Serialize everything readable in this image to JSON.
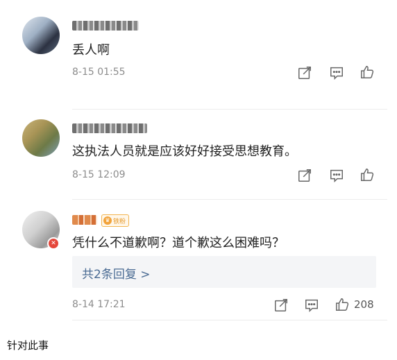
{
  "comments": [
    {
      "username": "",
      "text": "丢人啊",
      "time": "8-15 01:55",
      "actions": {
        "share_icon": "share-icon",
        "reply_icon": "comment-icon",
        "like_icon": "thumbs-up-icon"
      }
    },
    {
      "username": "",
      "text": "这执法人员就是应该好好接受思想教育。",
      "time": "8-15 12:09",
      "actions": {
        "share_icon": "share-icon",
        "reply_icon": "comment-icon",
        "like_icon": "thumbs-up-icon"
      }
    },
    {
      "username": "",
      "badge": "铁粉",
      "text": "凭什么不道歉啊？道个歉这么困难吗？",
      "replies_label": "共2条回复 >",
      "time": "8-14 17:21",
      "like_count": "208",
      "actions": {
        "share_icon": "share-icon",
        "reply_icon": "comment-icon",
        "like_icon": "thumbs-up-icon"
      }
    }
  ],
  "footer": {
    "text": "针对此事"
  },
  "colors": {
    "link": "#4a6b93",
    "time": "#8c8c8c",
    "badge": "#f2a33a",
    "divider": "#ececec"
  }
}
